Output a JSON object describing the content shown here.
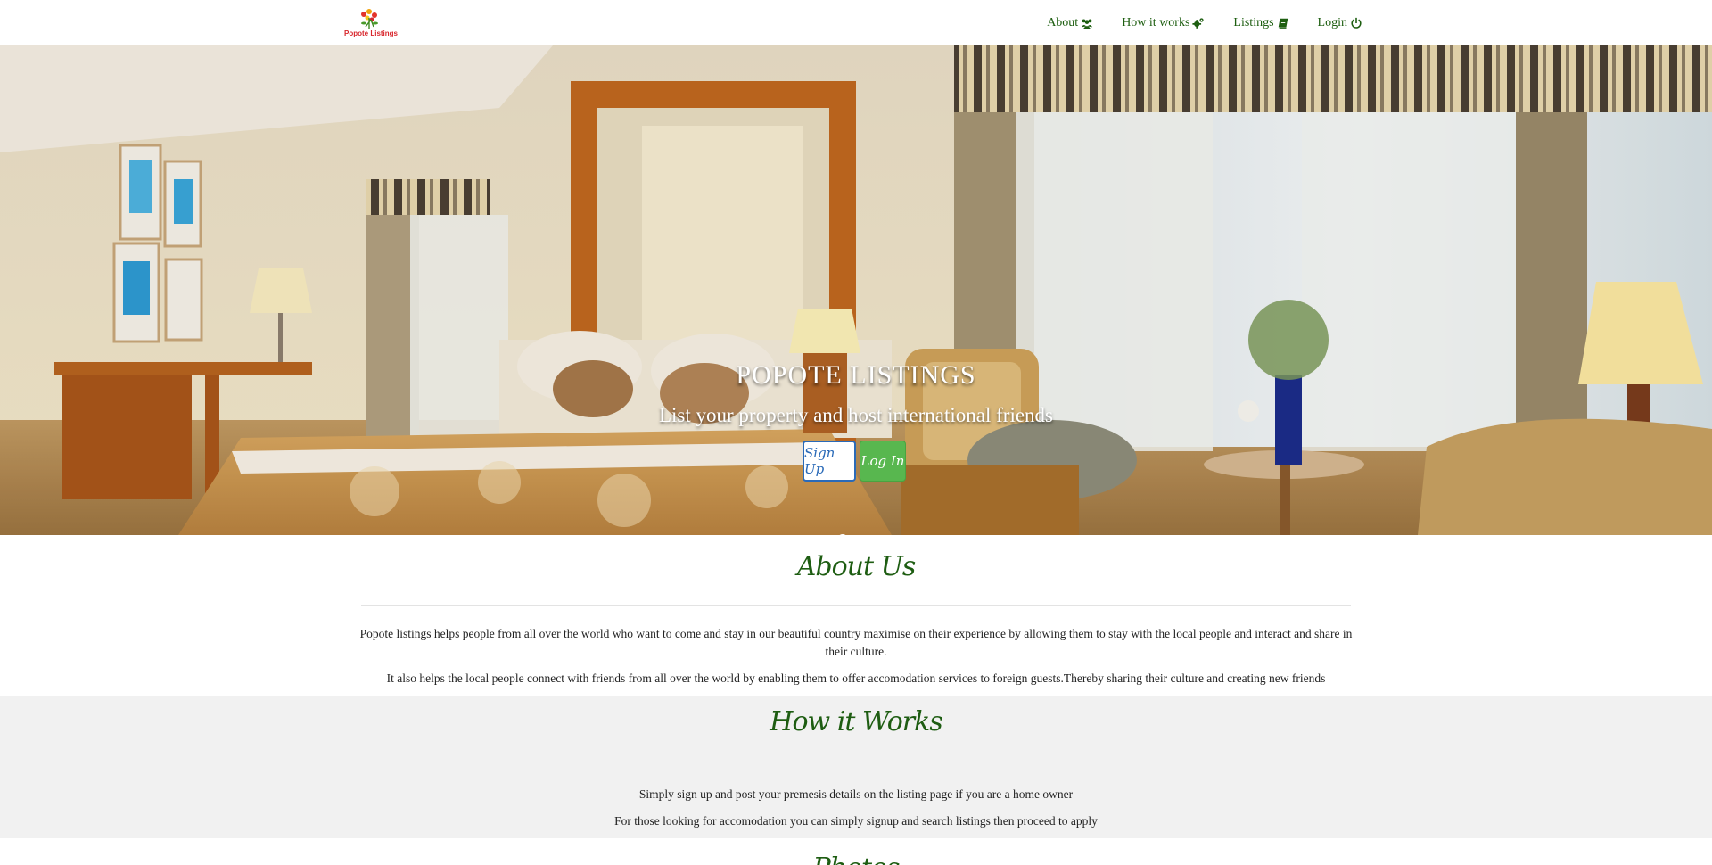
{
  "nav": {
    "logo_text": "Popote Listings",
    "links": [
      {
        "label": "About",
        "icon": "users-icon"
      },
      {
        "label": "How it works",
        "icon": "cogs-icon"
      },
      {
        "label": "Listings",
        "icon": "book-icon"
      },
      {
        "label": "Login",
        "icon": "power-icon"
      }
    ]
  },
  "hero": {
    "title": "POPOTE LISTINGS",
    "subtitle": "List your property and host international friends",
    "signup_label": "Sign Up",
    "login_label": "Log In",
    "slides": 3,
    "active_slide": 1
  },
  "about": {
    "title": "About Us",
    "paragraph1": "Popote listings helps people from all over the world who want to come and stay in our beautiful country maximise on their experience by allowing them to stay with the local people and interact and share in their culture.",
    "paragraph2": "It also helps the local people connect with friends from all over the world by enabling them to offer accomodation services to foreign guests.Thereby sharing their culture and creating new friends"
  },
  "how": {
    "title": "How it Works",
    "paragraph1": "Simply sign up and post your premesis details on the listing page if you are a home owner",
    "paragraph2": "For those looking for accomodation you can simply signup and search listings then proceed to apply"
  },
  "next": {
    "title": "Photos"
  },
  "colors": {
    "brand_green": "#1e5d12",
    "login_button": "#58b74f",
    "signup_border": "#2a6ab8",
    "section_gray": "#f1f1f1"
  }
}
